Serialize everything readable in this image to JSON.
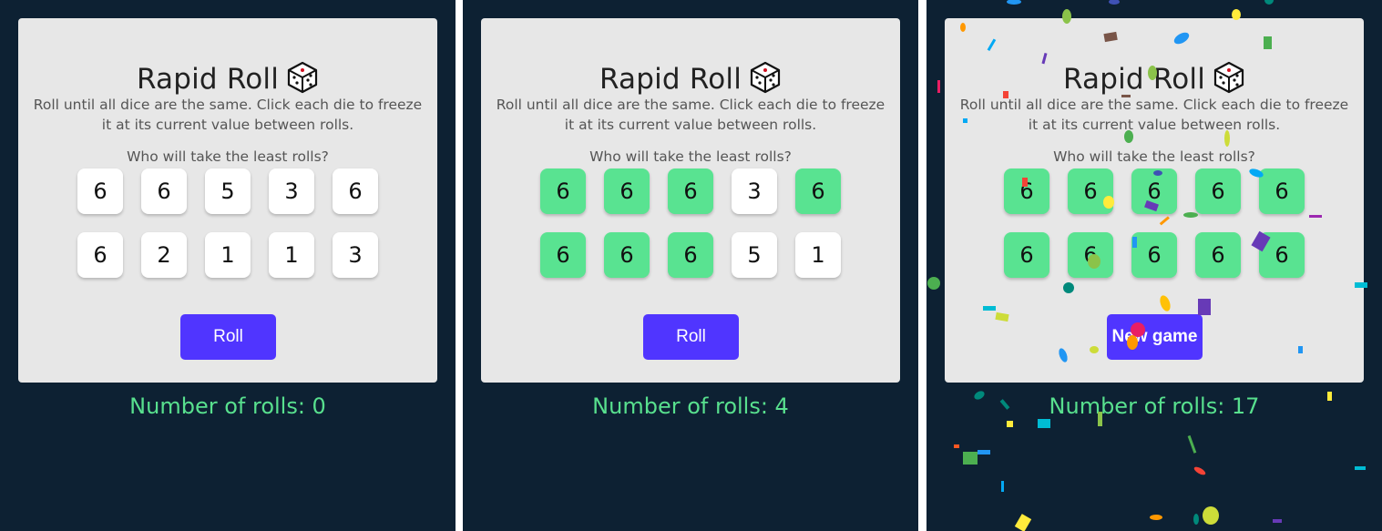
{
  "colors": {
    "background": "#0d2133",
    "card": "#e7e7e7",
    "die_unheld": "#ffffff",
    "die_held": "#59e391",
    "button": "#5035ff",
    "count_text": "#58e08e"
  },
  "title_icon": "game-die-icon",
  "panels": [
    {
      "title": "Rapid Roll",
      "description": "Roll until all dice are the same. Click each die to freeze it at its current value between rolls.",
      "question": "Who will take the least rolls?",
      "dice": [
        {
          "value": "6",
          "held": false
        },
        {
          "value": "6",
          "held": false
        },
        {
          "value": "5",
          "held": false
        },
        {
          "value": "3",
          "held": false
        },
        {
          "value": "6",
          "held": false
        },
        {
          "value": "6",
          "held": false
        },
        {
          "value": "2",
          "held": false
        },
        {
          "value": "1",
          "held": false
        },
        {
          "value": "1",
          "held": false
        },
        {
          "value": "3",
          "held": false
        }
      ],
      "button_label": "Roll",
      "rolls_text": "Number of rolls: 0"
    },
    {
      "title": "Rapid Roll",
      "description": "Roll until all dice are the same. Click each die to freeze it at its current value between rolls.",
      "question": "Who will take the least rolls?",
      "dice": [
        {
          "value": "6",
          "held": true
        },
        {
          "value": "6",
          "held": true
        },
        {
          "value": "6",
          "held": true
        },
        {
          "value": "3",
          "held": false
        },
        {
          "value": "6",
          "held": true
        },
        {
          "value": "6",
          "held": true
        },
        {
          "value": "6",
          "held": true
        },
        {
          "value": "6",
          "held": true
        },
        {
          "value": "5",
          "held": false
        },
        {
          "value": "1",
          "held": false
        }
      ],
      "button_label": "Roll",
      "rolls_text": "Number of rolls: 4"
    },
    {
      "title": "Rapid Roll",
      "description": "Roll until all dice are the same. Click each die to freeze it at its current value between rolls.",
      "question": "Who will take the least rolls?",
      "dice": [
        {
          "value": "6",
          "held": true
        },
        {
          "value": "6",
          "held": true
        },
        {
          "value": "6",
          "held": true
        },
        {
          "value": "6",
          "held": true
        },
        {
          "value": "6",
          "held": true
        },
        {
          "value": "6",
          "held": true
        },
        {
          "value": "6",
          "held": true
        },
        {
          "value": "6",
          "held": true
        },
        {
          "value": "6",
          "held": true
        },
        {
          "value": "6",
          "held": true
        }
      ],
      "button_label": "New game",
      "rolls_text": "Number of rolls: 17",
      "confetti": true
    }
  ]
}
